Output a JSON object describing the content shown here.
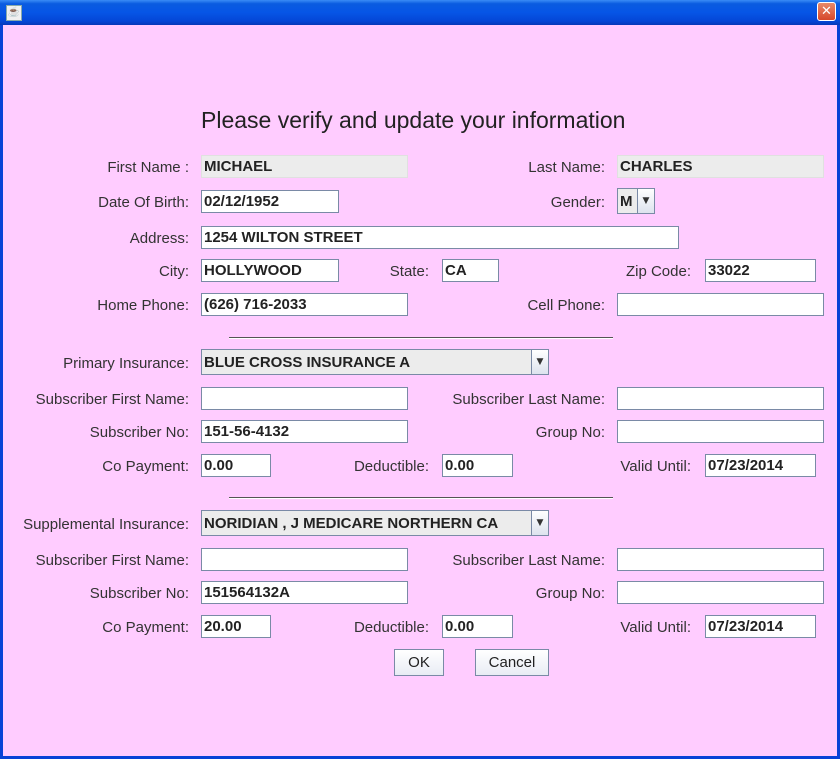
{
  "window": {
    "close_glyph": "✕",
    "icon": "java-icon"
  },
  "heading": "Please verify and update your information",
  "personal": {
    "first_name_label": "First Name :",
    "first_name": "MICHAEL",
    "last_name_label": "Last Name:",
    "last_name": "CHARLES",
    "dob_label": "Date Of Birth:",
    "dob": "02/12/1952",
    "gender_label": "Gender:",
    "gender": "M",
    "address_label": "Address:",
    "address": "1254 WILTON STREET",
    "city_label": "City:",
    "city": "HOLLYWOOD",
    "state_label": "State:",
    "state": "CA",
    "zip_label": "Zip Code:",
    "zip": "33022",
    "home_phone_label": "Home Phone:",
    "home_phone": "(626) 716-2033",
    "cell_phone_label": "Cell Phone:",
    "cell_phone": ""
  },
  "primary": {
    "insurance_label": "Primary Insurance:",
    "insurance": "BLUE CROSS INSURANCE A",
    "sub_first_label": "Subscriber First Name:",
    "sub_first": "",
    "sub_last_label": "Subscriber Last Name:",
    "sub_last": "",
    "sub_no_label": "Subscriber No:",
    "sub_no": "151-56-4132",
    "group_label": "Group No:",
    "group": "",
    "copay_label": "Co Payment:",
    "copay": "0.00",
    "deductible_label": "Deductible:",
    "deductible": "0.00",
    "valid_label": "Valid Until:",
    "valid": "07/23/2014"
  },
  "supplemental": {
    "insurance_label": "Supplemental Insurance:",
    "insurance": "NORIDIAN  , J  MEDICARE NORTHERN CA",
    "sub_first_label": "Subscriber First Name:",
    "sub_first": "",
    "sub_last_label": "Subscriber Last Name:",
    "sub_last": "",
    "sub_no_label": "Subscriber No:",
    "sub_no": "151564132A",
    "group_label": "Group No:",
    "group": "",
    "copay_label": "Co Payment:",
    "copay": "20.00",
    "deductible_label": "Deductible:",
    "deductible": "0.00",
    "valid_label": "Valid Until:",
    "valid": "07/23/2014"
  },
  "buttons": {
    "ok": "OK",
    "cancel": "Cancel"
  },
  "dropdown_glyph": "▼"
}
